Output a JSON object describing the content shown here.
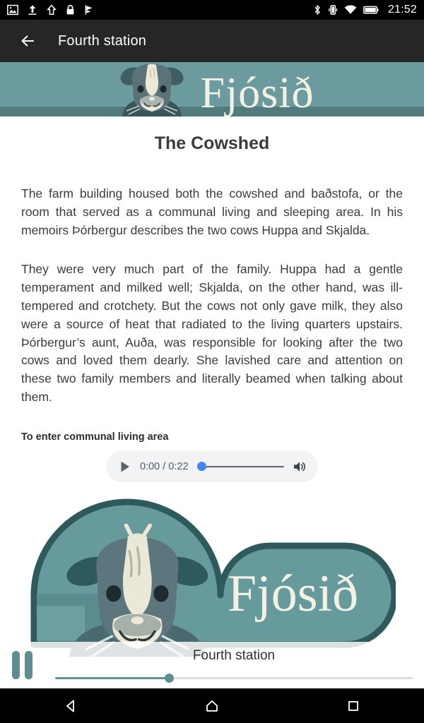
{
  "status_bar": {
    "time": "21:52",
    "left_icons": [
      "image-icon",
      "upload-icon",
      "arrow-up-icon",
      "lock-icon",
      "flag-icon"
    ],
    "right_icons": [
      "bluetooth-icon",
      "vibrate-icon",
      "wifi-icon",
      "battery-icon"
    ]
  },
  "app_bar": {
    "back_label": "back-arrow",
    "title": "Fourth station"
  },
  "banner": {
    "word": "Fjósið",
    "bg_color": "#6b9b9e",
    "floor_color": "#517b7c",
    "text_color": "#f2f1e4"
  },
  "article": {
    "title": "The Cowshed",
    "paragraphs": [
      "The farm building housed both the cowshed and baðstofa, or the room that served as a communal living and sleeping area. In his memoirs Þórbergur describes the two cows Huppa and Skjalda.",
      "They were very much part of the family. Huppa had a gentle temperament and milked well; Skjalda, on the other hand, was ill-tempered and crotchety. But the cows not only gave milk, they also were a source of heat that radiated to the living quarters upstairs. Þórbergur’s aunt, Auða, was responsible for looking after the two cows and loved them dearly. She lavished care and attention on these two family members and literally beamed when talking about them."
    ]
  },
  "audio_section": {
    "label": "To enter communal living area",
    "player": {
      "play_icon": "play-icon",
      "time_display": "0:00 / 0:22",
      "current_time": "0:00",
      "duration": "0:22",
      "progress_percent": 0,
      "volume_icon": "volume-icon",
      "accent_color": "#4285f4"
    }
  },
  "logo": {
    "word": "Fjósið",
    "badge_fill": "#679a9d",
    "badge_outline": "#2f5a5b",
    "text_color": "#f2f1e4"
  },
  "bottom_player": {
    "toggle_icon": "pause-icon",
    "title": "Fourth station",
    "progress_percent": 32,
    "accent_color": "#5f8e91"
  },
  "nav_bar": {
    "buttons": [
      "back-nav-icon",
      "home-nav-icon",
      "recents-nav-icon"
    ]
  }
}
